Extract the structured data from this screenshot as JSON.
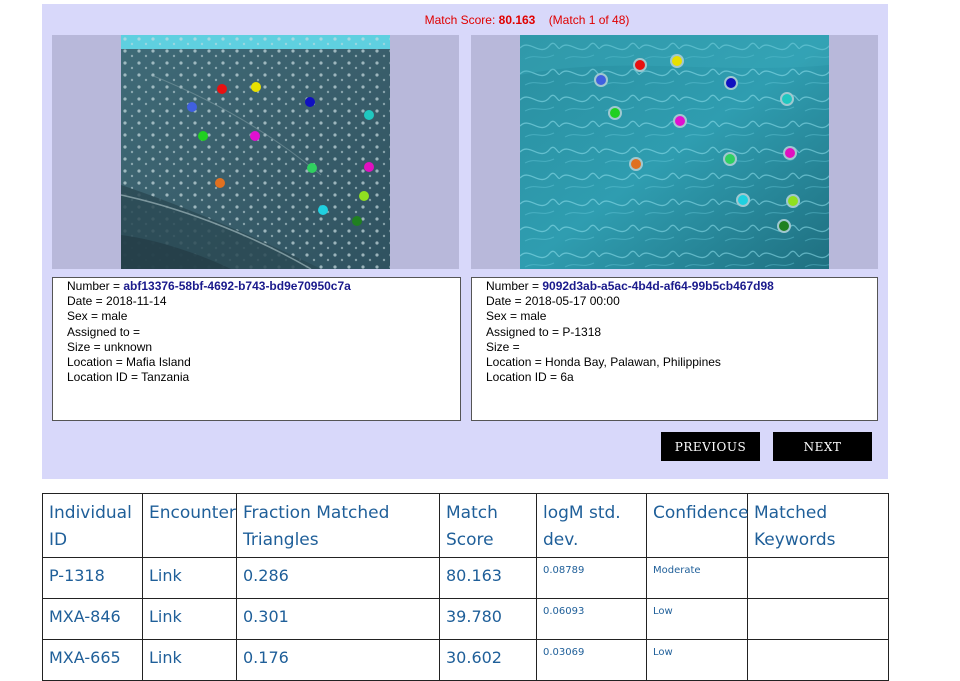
{
  "match": {
    "score_label": "Match Score:",
    "score_value": "80.163",
    "match_of": "(Match 1 of 48)"
  },
  "colors": {
    "panel_bg": "#d8d8fa",
    "score_text": "#e00000",
    "link_text": "#1f5f99",
    "number_text": "#1a1a8c"
  },
  "left_encounter": {
    "number_label": "Number = ",
    "number": "abf13376-58bf-4692-b743-bd9e70950c7a",
    "lines": [
      "Date = 2018-11-14",
      "Sex = male",
      "Assigned to = ",
      "Size = unknown",
      "Location = Mafia Island",
      "Location ID = Tanzania"
    ],
    "spot_colors": [
      "#e81010",
      "#e8e000",
      "#4060e0",
      "#1010c0",
      "#20c8c0",
      "#20d020",
      "#e010d0",
      "#30d060",
      "#e010c0",
      "#e07020",
      "#90e020",
      "#20d0e0",
      "#208020"
    ]
  },
  "right_encounter": {
    "number_label": "Number = ",
    "number": "9092d3ab-a5ac-4b4d-af64-99b5cb467d98",
    "lines": [
      "Date = 2018-05-17 00:00",
      "Sex = male",
      "Assigned to = P-1318",
      "Size = ",
      "Location = Honda Bay, Palawan, Philippines",
      "Location ID = 6a"
    ],
    "spot_colors": [
      "#e81010",
      "#e8e000",
      "#4060e0",
      "#1010c0",
      "#20c8c0",
      "#20d020",
      "#e010d0",
      "#30d060",
      "#e010c0",
      "#e07020",
      "#90e020",
      "#20d0e0",
      "#208020"
    ]
  },
  "buttons": {
    "previous": "Previous",
    "next": "Next"
  },
  "table": {
    "headers": [
      "Individual ID",
      "Encounter",
      "Fraction Matched Triangles",
      "Match Score",
      "logM std. dev.",
      "Confidence",
      "Matched Keywords"
    ],
    "rows": [
      {
        "id": "P-1318",
        "encounter": "Link",
        "fraction": "0.286",
        "score": "80.163",
        "logm": "0.08789",
        "confidence": "Moderate",
        "keywords": ""
      },
      {
        "id": "MXA-846",
        "encounter": "Link",
        "fraction": "0.301",
        "score": "39.780",
        "logm": "0.06093",
        "confidence": "Low",
        "keywords": ""
      },
      {
        "id": "MXA-665",
        "encounter": "Link",
        "fraction": "0.176",
        "score": "30.602",
        "logm": "0.03069",
        "confidence": "Low",
        "keywords": ""
      }
    ]
  }
}
